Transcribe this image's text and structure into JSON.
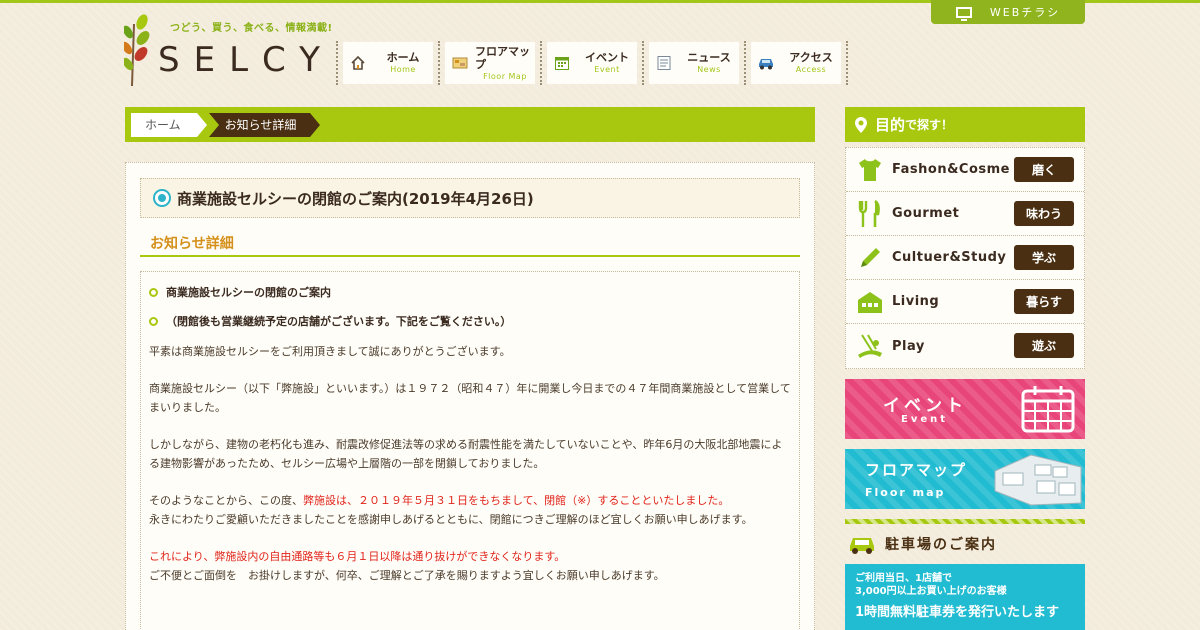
{
  "header": {
    "tagline": "つどう、買う、食べる、情報満載!",
    "logo_text": "SELCY",
    "web_flyer": "WEBチラシ",
    "nav": [
      {
        "jp": "ホーム",
        "en": "Home",
        "icon": "house-icon"
      },
      {
        "jp": "フロアマップ",
        "en": "Floor Map",
        "icon": "map-icon"
      },
      {
        "jp": "イベント",
        "en": "Event",
        "icon": "calendar-icon"
      },
      {
        "jp": "ニュース",
        "en": "News",
        "icon": "news-icon"
      },
      {
        "jp": "アクセス",
        "en": "Access",
        "icon": "car-icon"
      }
    ]
  },
  "breadcrumb": {
    "home": "ホーム",
    "current": "お知らせ詳細"
  },
  "article": {
    "title": "商業施設セルシーの閉館のご案内(2019年4月26日)",
    "section_heading": "お知らせ詳細",
    "bullets": [
      "商業施設セルシーの閉館のご案内",
      "（閉館後も営業継続予定の店舗がございます。下記をご覧ください。）"
    ],
    "p1": "平素は商業施設セルシーをご利用頂きまして誠にありがとうございます。",
    "p2": "商業施設セルシー（以下「弊施設」といいます。）は１９７２（昭和４７）年に開業し今日までの４７年間商業施設として営業してまいりました。",
    "p3": "しかしながら、建物の老朽化も進み、耐震改修促進法等の求める耐震性能を満たしていないことや、昨年6月の大阪北部地震による建物影響があったため、セルシー広場や上層階の一部を閉鎖しておりました。",
    "p4_pre": "そのようなことから、この度、",
    "p4_red": "弊施設は、２０１９年５月３１日をもちまして、閉館（※）することといたしました。",
    "p4_post": "永きにわたりご愛顧いただきましたことを感謝申しあげるとともに、閉館につきご理解のほど宜しくお願い申しあげます。",
    "p5_red": "これにより、弊施設内の自由通路等も６月１日以降は通り抜けができなくなります。",
    "p5_post": "ご不便とご面倒を　お掛けしますが、何卒、ご理解とご了承を賜りますよう宜しくお願い申しあげます。"
  },
  "sidebar": {
    "head_main": "目的",
    "head_sub": "で探す！",
    "categories": [
      {
        "name": "Fashon&Cosme",
        "button": "磨く",
        "icon": "tshirt-icon"
      },
      {
        "name": "Gourmet",
        "button": "味わう",
        "icon": "fork-knife-icon"
      },
      {
        "name": "Cultuer&Study",
        "button": "学ぶ",
        "icon": "pencil-icon"
      },
      {
        "name": "Living",
        "button": "暮らす",
        "icon": "house-icon"
      },
      {
        "name": "Play",
        "button": "遊ぶ",
        "icon": "swing-icon"
      }
    ],
    "event_banner": {
      "title": "イベント",
      "sub": "Event"
    },
    "floor_banner": {
      "title": "フロアマップ",
      "sub": "Floor map"
    },
    "parking": {
      "heading": "駐車場のご案内",
      "line1": "ご利用当日、1店舗で",
      "line2": "3,000円以上お買い上げのお客様",
      "line3": "1時間無料駐車券を発行いたします"
    }
  },
  "colors": {
    "accent_green": "#a8c80f",
    "brown": "#4a2f12",
    "event_pink": "#e8457a",
    "floor_cyan": "#21bcd1",
    "alert_red": "#e0241a"
  }
}
